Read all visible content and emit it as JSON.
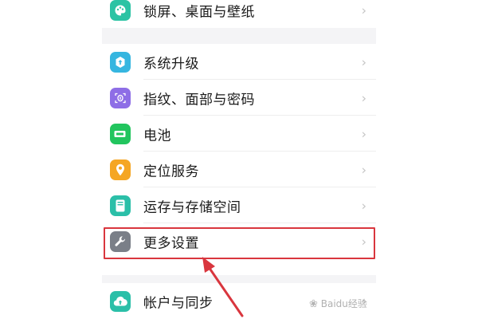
{
  "settings": {
    "items": [
      {
        "label": "锁屏、桌面与壁纸",
        "icon": "palette-icon",
        "color": "#2cc3a4"
      },
      {
        "label": "系统升级",
        "icon": "system-update-icon",
        "color": "#36b6e0"
      },
      {
        "label": "指纹、面部与密码",
        "icon": "fingerprint-icon",
        "color": "#8e6ee6"
      },
      {
        "label": "电池",
        "icon": "battery-icon",
        "color": "#22c55e"
      },
      {
        "label": "定位服务",
        "icon": "location-pin-icon",
        "color": "#f5a623"
      },
      {
        "label": "运存与存储空间",
        "icon": "storage-icon",
        "color": "#2bbfa8"
      },
      {
        "label": "更多设置",
        "icon": "wrench-icon",
        "color": "#7a7f88"
      },
      {
        "label": "帐户与同步",
        "icon": "cloud-sync-icon",
        "color": "#2bbfa8"
      }
    ],
    "chevron": "›"
  },
  "annotation": {
    "highlight_color": "#d9363e",
    "highlighted_item": "更多设置"
  },
  "watermark": {
    "text": "Baidu经验",
    "paw": "❀"
  }
}
